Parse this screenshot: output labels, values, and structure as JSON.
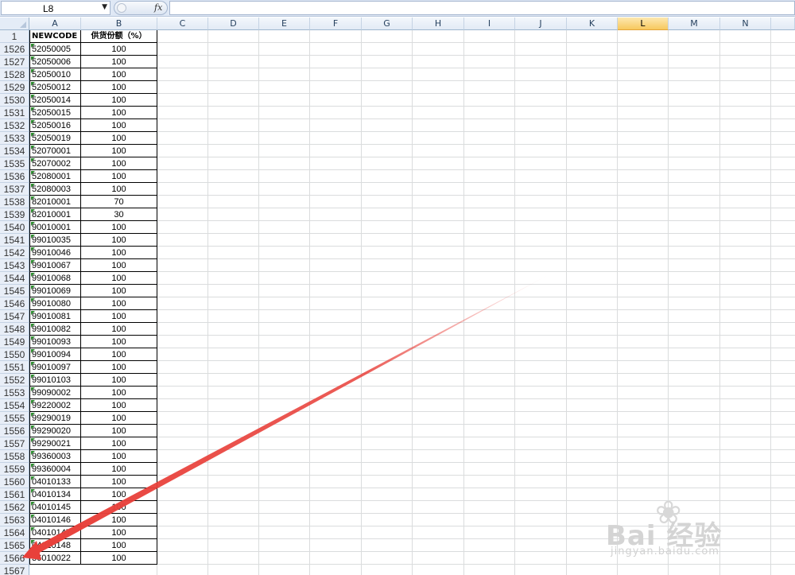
{
  "name_box": {
    "value": "L8"
  },
  "formula_bar": {
    "fx_label": "fx",
    "value": ""
  },
  "columns": [
    "A",
    "B",
    "C",
    "D",
    "E",
    "F",
    "G",
    "H",
    "I",
    "J",
    "K",
    "L",
    "M",
    "N"
  ],
  "active_column": "L",
  "header_row": {
    "row_number": "1",
    "col_a": "NEWCODE",
    "col_b": "供货份额（%）"
  },
  "rows": [
    {
      "row": "1526",
      "code": "52050005",
      "share": "100"
    },
    {
      "row": "1527",
      "code": "52050006",
      "share": "100"
    },
    {
      "row": "1528",
      "code": "52050010",
      "share": "100"
    },
    {
      "row": "1529",
      "code": "52050012",
      "share": "100"
    },
    {
      "row": "1530",
      "code": "52050014",
      "share": "100"
    },
    {
      "row": "1531",
      "code": "52050015",
      "share": "100"
    },
    {
      "row": "1532",
      "code": "52050016",
      "share": "100"
    },
    {
      "row": "1533",
      "code": "52050019",
      "share": "100"
    },
    {
      "row": "1534",
      "code": "52070001",
      "share": "100"
    },
    {
      "row": "1535",
      "code": "52070002",
      "share": "100"
    },
    {
      "row": "1536",
      "code": "52080001",
      "share": "100"
    },
    {
      "row": "1537",
      "code": "52080003",
      "share": "100"
    },
    {
      "row": "1538",
      "code": "82010001",
      "share": "70"
    },
    {
      "row": "1539",
      "code": "82010001",
      "share": "30"
    },
    {
      "row": "1540",
      "code": "90010001",
      "share": "100"
    },
    {
      "row": "1541",
      "code": "99010035",
      "share": "100"
    },
    {
      "row": "1542",
      "code": "99010046",
      "share": "100"
    },
    {
      "row": "1543",
      "code": "99010067",
      "share": "100"
    },
    {
      "row": "1544",
      "code": "99010068",
      "share": "100"
    },
    {
      "row": "1545",
      "code": "99010069",
      "share": "100"
    },
    {
      "row": "1546",
      "code": "99010080",
      "share": "100"
    },
    {
      "row": "1547",
      "code": "99010081",
      "share": "100"
    },
    {
      "row": "1548",
      "code": "99010082",
      "share": "100"
    },
    {
      "row": "1549",
      "code": "99010093",
      "share": "100"
    },
    {
      "row": "1550",
      "code": "99010094",
      "share": "100"
    },
    {
      "row": "1551",
      "code": "99010097",
      "share": "100"
    },
    {
      "row": "1552",
      "code": "99010103",
      "share": "100"
    },
    {
      "row": "1553",
      "code": "99090002",
      "share": "100"
    },
    {
      "row": "1554",
      "code": "99220002",
      "share": "100"
    },
    {
      "row": "1555",
      "code": "99290019",
      "share": "100"
    },
    {
      "row": "1556",
      "code": "99290020",
      "share": "100"
    },
    {
      "row": "1557",
      "code": "99290021",
      "share": "100"
    },
    {
      "row": "1558",
      "code": "99360003",
      "share": "100"
    },
    {
      "row": "1559",
      "code": "99360004",
      "share": "100"
    },
    {
      "row": "1560",
      "code": "04010133",
      "share": "100"
    },
    {
      "row": "1561",
      "code": "04010134",
      "share": "100"
    },
    {
      "row": "1562",
      "code": "04010145",
      "share": "100"
    },
    {
      "row": "1563",
      "code": "04010146",
      "share": "100"
    },
    {
      "row": "1564",
      "code": "04010147",
      "share": "100"
    },
    {
      "row": "1565",
      "code": "04010148",
      "share": "100"
    },
    {
      "row": "1566",
      "code": "36010022",
      "share": "100"
    }
  ],
  "trailing_row": "1567",
  "annotation": {
    "arrow_color": "#e8403a"
  },
  "watermark": {
    "text": "Bai 经验",
    "url": "jingyan.baidu.com"
  }
}
